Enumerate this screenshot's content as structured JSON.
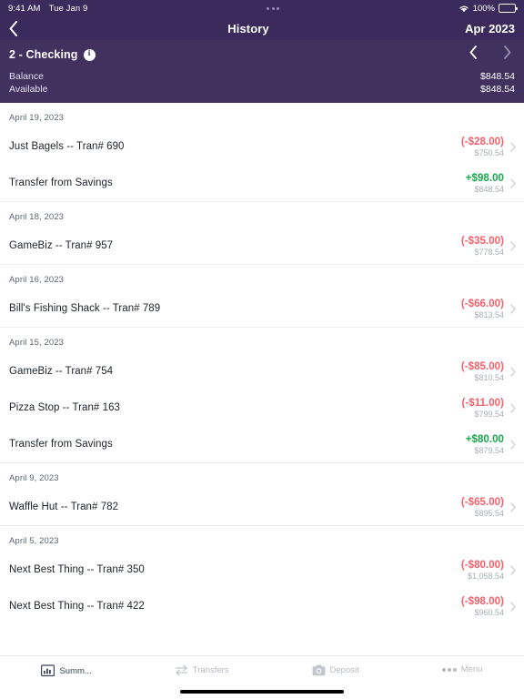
{
  "status_bar": {
    "time": "9:41 AM",
    "date": "Tue Jan 9",
    "battery_percent": "100%",
    "wifi_icon": "wifi-icon",
    "battery_icon": "battery-icon"
  },
  "navbar": {
    "back_icon": "chevron-left-icon",
    "title": "History",
    "period": "Apr 2023"
  },
  "account": {
    "name": "2 - Checking",
    "info_icon": "info-icon",
    "info_glyph": "i",
    "prev_icon": "chevron-left-icon",
    "next_icon": "chevron-right-icon",
    "balance_label": "Balance",
    "balance_value": "$848.54",
    "available_label": "Available",
    "available_value": "$848.54"
  },
  "colors": {
    "header_purple": "#3d2a5c",
    "account_purple": "#42305f",
    "debit_red": "#f4606a",
    "credit_green": "#17a84a",
    "balance_gray": "#a7adb6"
  },
  "transaction_groups": [
    {
      "date": "April 19, 2023",
      "transactions": [
        {
          "description": "Just Bagels -- Tran# 690",
          "amount": "(-$28.00)",
          "type": "debit",
          "running_balance": "$750.54"
        },
        {
          "description": "Transfer from Savings",
          "amount": "+$98.00",
          "type": "credit",
          "running_balance": "$848.54"
        }
      ]
    },
    {
      "date": "April 18, 2023",
      "transactions": [
        {
          "description": "GameBiz -- Tran# 957",
          "amount": "(-$35.00)",
          "type": "debit",
          "running_balance": "$778.54"
        }
      ]
    },
    {
      "date": "April 16, 2023",
      "transactions": [
        {
          "description": "Bill's Fishing Shack -- Tran# 789",
          "amount": "(-$66.00)",
          "type": "debit",
          "running_balance": "$813.54"
        }
      ]
    },
    {
      "date": "April 15, 2023",
      "transactions": [
        {
          "description": "GameBiz -- Tran# 754",
          "amount": "(-$85.00)",
          "type": "debit",
          "running_balance": "$810.54"
        },
        {
          "description": "Pizza Stop -- Tran# 163",
          "amount": "(-$11.00)",
          "type": "debit",
          "running_balance": "$799.54"
        },
        {
          "description": "Transfer from Savings",
          "amount": "+$80.00",
          "type": "credit",
          "running_balance": "$879.54"
        }
      ]
    },
    {
      "date": "April 9, 2023",
      "transactions": [
        {
          "description": "Waffle Hut -- Tran# 782",
          "amount": "(-$65.00)",
          "type": "debit",
          "running_balance": "$895.54"
        }
      ]
    },
    {
      "date": "April 5, 2023",
      "transactions": [
        {
          "description": "Next Best Thing -- Tran# 350",
          "amount": "(-$80.00)",
          "type": "debit",
          "running_balance": "$1,058.54"
        },
        {
          "description": "Next Best Thing -- Tran# 422",
          "amount": "(-$98.00)",
          "type": "debit",
          "running_balance": "$960.54"
        }
      ]
    }
  ],
  "tabbar": {
    "items": [
      {
        "label": "Summ...",
        "icon": "bar-chart-icon",
        "active": true
      },
      {
        "label": "Transfers",
        "icon": "transfer-arrows-icon",
        "active": false
      },
      {
        "label": "Deposit",
        "icon": "camera-icon",
        "active": false
      },
      {
        "label": "Menu",
        "icon": "three-dots-icon",
        "active": false
      }
    ]
  }
}
